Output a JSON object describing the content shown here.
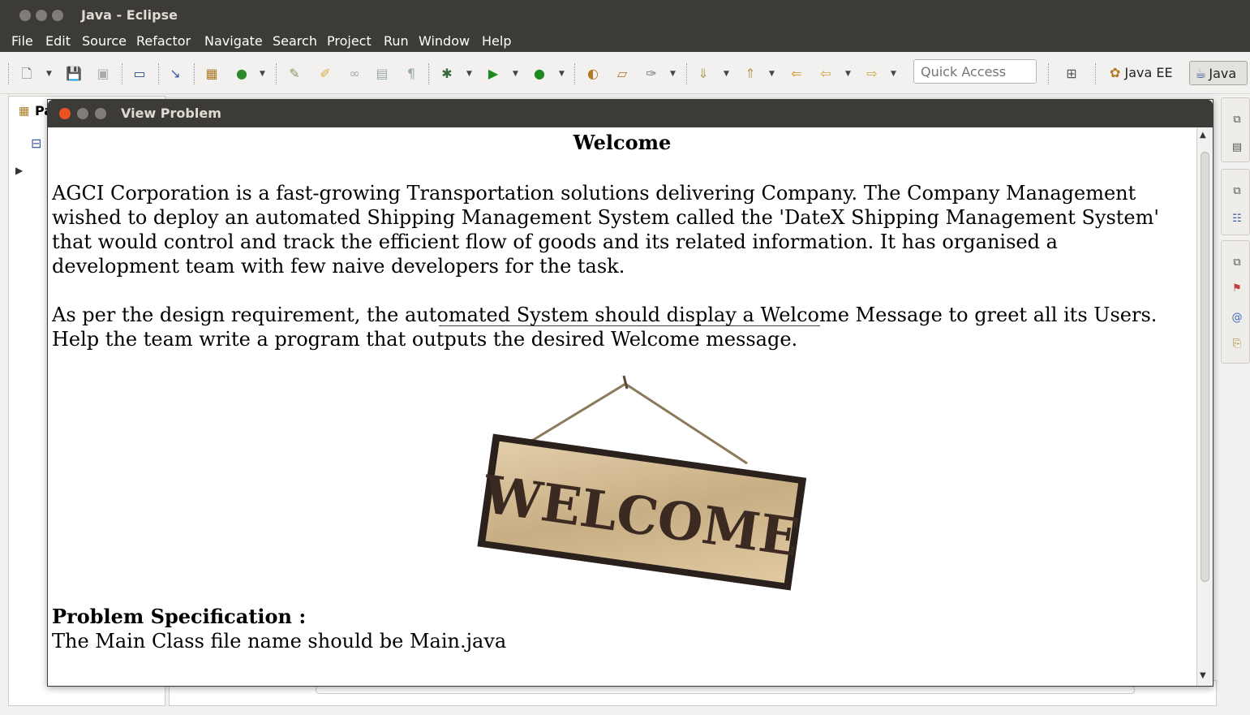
{
  "window": {
    "title": "Java - Eclipse"
  },
  "menu": [
    "File",
    "Edit",
    "Source",
    "Refactor",
    "Navigate",
    "Search",
    "Project",
    "Run",
    "Window",
    "Help"
  ],
  "toolbar": {
    "quick_access_placeholder": "Quick Access",
    "perspectives": [
      "Java EE",
      "Java"
    ]
  },
  "left_panel": {
    "tab_label_fragment": "Pa"
  },
  "dialog": {
    "title": "View Problem",
    "heading": "Welcome",
    "paragraph1": "AGCI Corporation is a fast-growing Transportation solutions delivering Company. The Company Management wished to deploy an automated Shipping Management System called the 'DateX Shipping Management System' that would control and track the efficient flow of goods and its related information. It has organised a development team with few naive developers for the task.",
    "paragraph2": "As per the design requirement, the automated System should display a Welcome Message to greet all its Users. Help the team write a program that outputs the desired Welcome message.",
    "image_sign_text": "WELCOME",
    "spec_title": "Problem Specification :",
    "spec_text": "The Main Class file name should be Main.java"
  },
  "colors": {
    "titlebar": "#3c3b37",
    "close_button": "#e95420",
    "sign_wood": "#d9c19a",
    "sign_text": "#3b2a22"
  }
}
